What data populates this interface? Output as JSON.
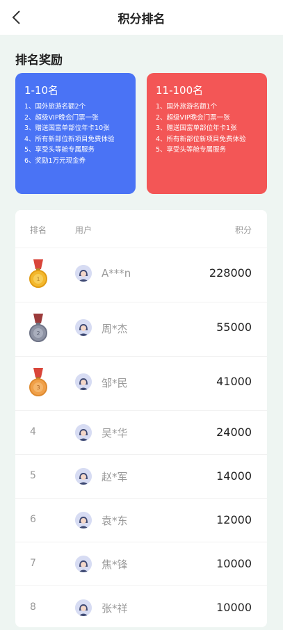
{
  "header": {
    "title": "积分排名"
  },
  "section_title": "排名奖励",
  "rewards": [
    {
      "title": "1-10名",
      "color": "#4a73f5",
      "items": [
        "1、国外旅游名额2个",
        "2、超级VIP晚会门票一张",
        "3、赠送国富单部位年卡10张",
        "4、所有新部位新项目免费体验",
        "5、享受头等舱专属服务",
        "6、奖励1万元现金券"
      ]
    },
    {
      "title": "11-100名",
      "color": "#f35656",
      "items": [
        "1、国外旅游名额1个",
        "2、超级VIP晚会门票一张",
        "3、赠送国富单部位年卡1张",
        "4、所有新部位新项目免费体验",
        "5、享受头等舱专属服务"
      ]
    }
  ],
  "table": {
    "headers": {
      "rank": "排名",
      "user": "用户",
      "score": "积分"
    },
    "rows": [
      {
        "rank": "1",
        "medal": "gold",
        "name": "A***n",
        "score": "228000"
      },
      {
        "rank": "2",
        "medal": "silver",
        "name": "周*杰",
        "score": "55000"
      },
      {
        "rank": "3",
        "medal": "bronze",
        "name": "邹*民",
        "score": "41000"
      },
      {
        "rank": "4",
        "medal": "",
        "name": "吴*华",
        "score": "24000"
      },
      {
        "rank": "5",
        "medal": "",
        "name": "赵*军",
        "score": "14000"
      },
      {
        "rank": "6",
        "medal": "",
        "name": "袁*东",
        "score": "12000"
      },
      {
        "rank": "7",
        "medal": "",
        "name": "焦*锋",
        "score": "10000"
      },
      {
        "rank": "8",
        "medal": "",
        "name": "张*祥",
        "score": "10000"
      }
    ]
  }
}
